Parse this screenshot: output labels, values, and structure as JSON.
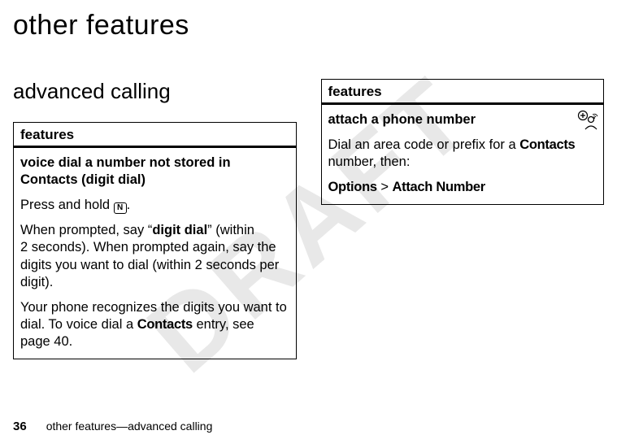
{
  "watermark": "DRAFT",
  "page_title": "other features",
  "section_heading": "advanced calling",
  "left_box": {
    "header": "features",
    "title_line1": "voice dial a number not stored in",
    "title_line2": "Contacts (digit dial)",
    "p1_a": "Press and hold ",
    "p1_key": "N",
    "p1_b": ".",
    "p2_a": "When prompted, say “",
    "p2_bold": "digit dial",
    "p2_b": "” (within 2 seconds). When prompted again, say the digits you want to dial (within 2 seconds per digit).",
    "p3_a": "Your phone recognizes the digits you want to dial. To voice dial a ",
    "p3_cond": "Contacts",
    "p3_b": " entry, see page 40."
  },
  "right_box": {
    "header": "features",
    "title": "attach a phone number",
    "p1_a": "Dial an area code or prefix for a ",
    "p1_cond": "Contacts",
    "p1_b": " number, then:",
    "nav_a": "Options",
    "nav_sep": " > ",
    "nav_b": "Attach Number"
  },
  "footer": {
    "page_number": "36",
    "text": "other features—advanced calling"
  }
}
